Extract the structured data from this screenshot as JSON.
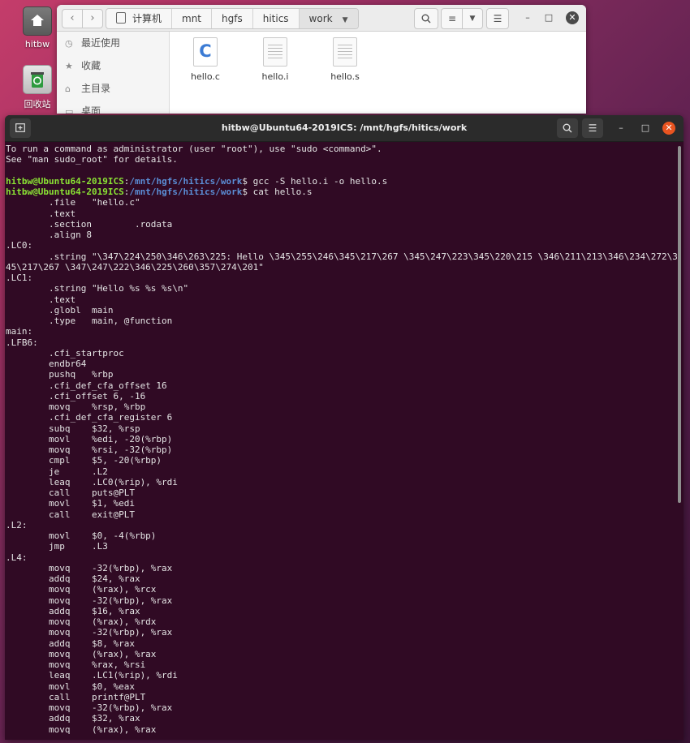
{
  "desktop": {
    "icons": [
      {
        "label": "hitbw",
        "icon": "home-folder-icon"
      },
      {
        "label": "回收站",
        "icon": "trash-icon"
      }
    ]
  },
  "file_manager": {
    "breadcrumbs": [
      "计算机",
      "mnt",
      "hgfs",
      "hitics",
      "work"
    ],
    "back_icon": "chevron-left-icon",
    "forward_icon": "chevron-right-icon",
    "sidebar": [
      {
        "label": "最近使用",
        "icon": "clock-icon"
      },
      {
        "label": "收藏",
        "icon": "star-icon"
      },
      {
        "label": "主目录",
        "icon": "home-icon"
      },
      {
        "label": "桌面",
        "icon": "desktop-icon"
      }
    ],
    "files": [
      {
        "name": "hello.c",
        "type": "c-source"
      },
      {
        "name": "hello.i",
        "type": "text"
      },
      {
        "name": "hello.s",
        "type": "text"
      }
    ]
  },
  "terminal": {
    "title": "hitbw@Ubuntu64-2019ICS: /mnt/hgfs/hitics/work",
    "prompt_user": "hitbw@Ubuntu64-2019ICS",
    "prompt_path": "/mnt/hgfs/hitics/work",
    "lines": [
      {
        "kind": "text",
        "text": "To run a command as administrator (user \"root\"), use \"sudo <command>\"."
      },
      {
        "kind": "text",
        "text": "See \"man sudo_root\" for details."
      },
      {
        "kind": "text",
        "text": ""
      },
      {
        "kind": "prompt",
        "text": " gcc -S hello.i -o hello.s"
      },
      {
        "kind": "prompt",
        "text": " cat hello.s"
      },
      {
        "kind": "text",
        "text": "\t.file\t\"hello.c\""
      },
      {
        "kind": "text",
        "text": "\t.text"
      },
      {
        "kind": "text",
        "text": "\t.section\t.rodata"
      },
      {
        "kind": "text",
        "text": "\t.align 8"
      },
      {
        "kind": "text",
        "text": ".LC0:"
      },
      {
        "kind": "text",
        "text": "\t.string \"\\347\\224\\250\\346\\263\\225: Hello \\345\\255\\246\\345\\217\\267 \\345\\247\\223\\345\\220\\215 \\346\\211\\213\\346\\234\\272\\3"
      },
      {
        "kind": "text",
        "text": "45\\217\\267 \\347\\247\\222\\346\\225\\260\\357\\274\\201\""
      },
      {
        "kind": "text",
        "text": ".LC1:"
      },
      {
        "kind": "text",
        "text": "\t.string \"Hello %s %s %s\\n\""
      },
      {
        "kind": "text",
        "text": "\t.text"
      },
      {
        "kind": "text",
        "text": "\t.globl\tmain"
      },
      {
        "kind": "text",
        "text": "\t.type\tmain, @function"
      },
      {
        "kind": "text",
        "text": "main:"
      },
      {
        "kind": "text",
        "text": ".LFB6:"
      },
      {
        "kind": "text",
        "text": "\t.cfi_startproc"
      },
      {
        "kind": "text",
        "text": "\tendbr64"
      },
      {
        "kind": "text",
        "text": "\tpushq\t%rbp"
      },
      {
        "kind": "text",
        "text": "\t.cfi_def_cfa_offset 16"
      },
      {
        "kind": "text",
        "text": "\t.cfi_offset 6, -16"
      },
      {
        "kind": "text",
        "text": "\tmovq\t%rsp, %rbp"
      },
      {
        "kind": "text",
        "text": "\t.cfi_def_cfa_register 6"
      },
      {
        "kind": "text",
        "text": "\tsubq\t$32, %rsp"
      },
      {
        "kind": "text",
        "text": "\tmovl\t%edi, -20(%rbp)"
      },
      {
        "kind": "text",
        "text": "\tmovq\t%rsi, -32(%rbp)"
      },
      {
        "kind": "text",
        "text": "\tcmpl\t$5, -20(%rbp)"
      },
      {
        "kind": "text",
        "text": "\tje\t.L2"
      },
      {
        "kind": "text",
        "text": "\tleaq\t.LC0(%rip), %rdi"
      },
      {
        "kind": "text",
        "text": "\tcall\tputs@PLT"
      },
      {
        "kind": "text",
        "text": "\tmovl\t$1, %edi"
      },
      {
        "kind": "text",
        "text": "\tcall\texit@PLT"
      },
      {
        "kind": "text",
        "text": ".L2:"
      },
      {
        "kind": "text",
        "text": "\tmovl\t$0, -4(%rbp)"
      },
      {
        "kind": "text",
        "text": "\tjmp\t.L3"
      },
      {
        "kind": "text",
        "text": ".L4:"
      },
      {
        "kind": "text",
        "text": "\tmovq\t-32(%rbp), %rax"
      },
      {
        "kind": "text",
        "text": "\taddq\t$24, %rax"
      },
      {
        "kind": "text",
        "text": "\tmovq\t(%rax), %rcx"
      },
      {
        "kind": "text",
        "text": "\tmovq\t-32(%rbp), %rax"
      },
      {
        "kind": "text",
        "text": "\taddq\t$16, %rax"
      },
      {
        "kind": "text",
        "text": "\tmovq\t(%rax), %rdx"
      },
      {
        "kind": "text",
        "text": "\tmovq\t-32(%rbp), %rax"
      },
      {
        "kind": "text",
        "text": "\taddq\t$8, %rax"
      },
      {
        "kind": "text",
        "text": "\tmovq\t(%rax), %rax"
      },
      {
        "kind": "text",
        "text": "\tmovq\t%rax, %rsi"
      },
      {
        "kind": "text",
        "text": "\tleaq\t.LC1(%rip), %rdi"
      },
      {
        "kind": "text",
        "text": "\tmovl\t$0, %eax"
      },
      {
        "kind": "text",
        "text": "\tcall\tprintf@PLT"
      },
      {
        "kind": "text",
        "text": "\tmovq\t-32(%rbp), %rax"
      },
      {
        "kind": "text",
        "text": "\taddq\t$32, %rax"
      },
      {
        "kind": "text",
        "text": "\tmovq\t(%rax), %rax"
      }
    ]
  },
  "colors": {
    "terminal_bg": "#300a24",
    "prompt_user": "#8ae234",
    "prompt_path": "#5b8ed6",
    "close_button": "#e95420"
  }
}
